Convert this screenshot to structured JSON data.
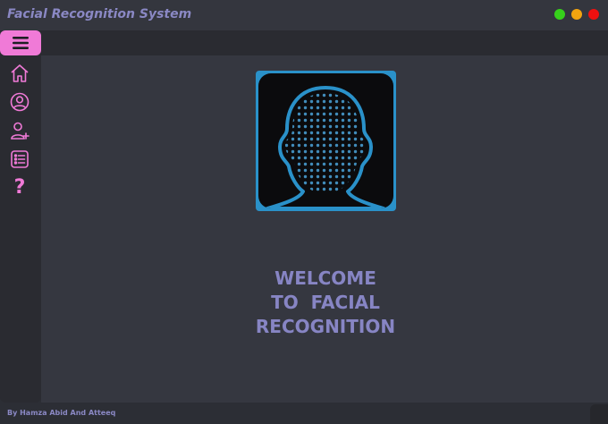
{
  "window": {
    "title": "Facial Recognition System",
    "controls": [
      "maximize",
      "minimize",
      "close"
    ],
    "colors": {
      "maximize": "#36d11b",
      "minimize": "#f2a40f",
      "close": "#f01010"
    }
  },
  "menu": {
    "icon": "hamburger-menu-icon",
    "color": "#f07ad7"
  },
  "sidebar": {
    "items": [
      {
        "icon": "home-icon"
      },
      {
        "icon": "user-circle-icon"
      },
      {
        "icon": "add-user-icon"
      },
      {
        "icon": "list-icon"
      },
      {
        "icon": "help-icon",
        "glyph": "?"
      }
    ],
    "accent": "#f07ad7"
  },
  "main": {
    "logo": {
      "icon": "face-scan-icon",
      "border_color": "#2a91c9"
    },
    "welcome_lines": [
      "WELCOME",
      "TO  FACIAL",
      "RECOGNITION"
    ],
    "welcome_color": "#8785c4"
  },
  "footer": {
    "credit": "By Hamza Abid And Atteeq"
  }
}
